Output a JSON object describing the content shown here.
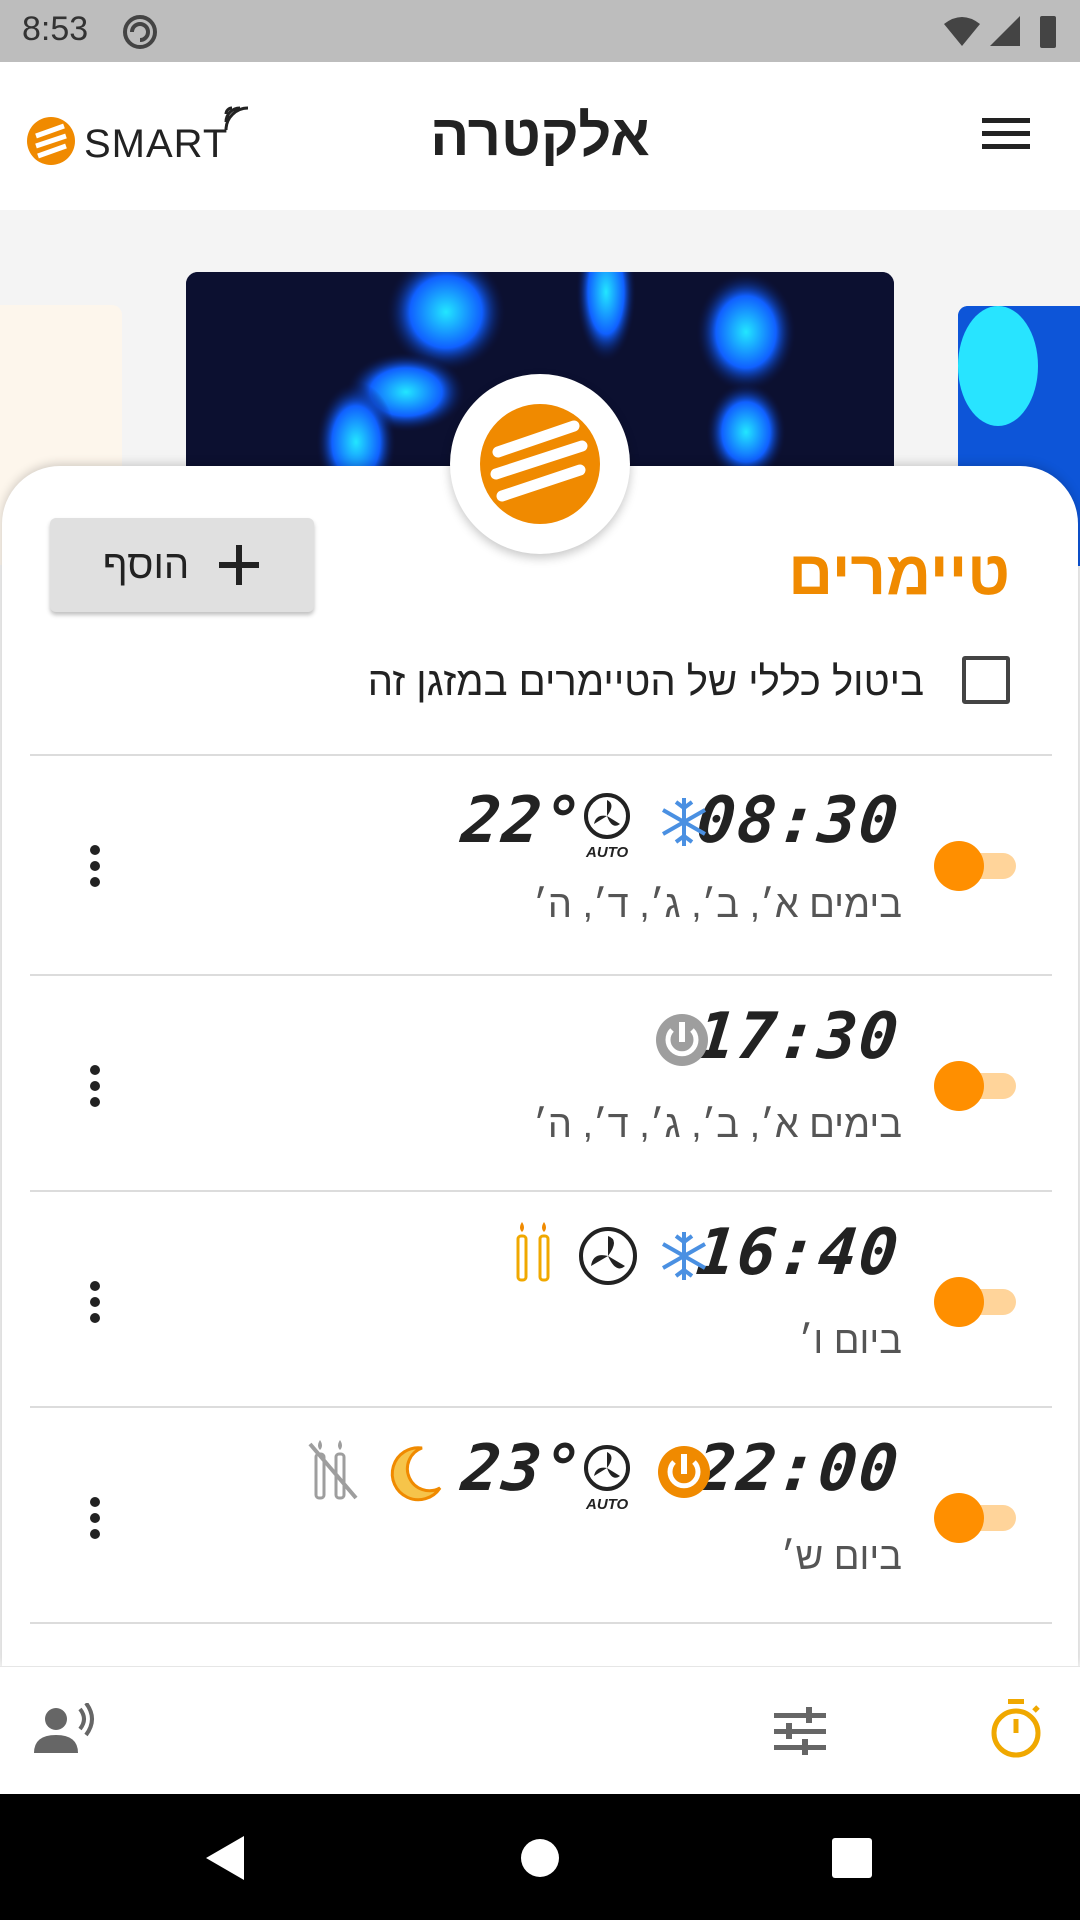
{
  "status": {
    "time": "8:53"
  },
  "app": {
    "smart_label": "SMART",
    "brand": "אלקטרה"
  },
  "timers": {
    "title": "טיימרים",
    "add_label": "הוסף",
    "cancel_all_label": "ביטול כללי של הטיימרים במזגן זה",
    "rows": [
      {
        "time": "08:30",
        "days": "בימים א׳, ב׳, ג׳, ד׳, ה׳",
        "temp": "22°",
        "fan_label": "AUTO",
        "mode": "cool",
        "enabled": true
      },
      {
        "time": "17:30",
        "days": "בימים א׳, ב׳, ג׳, ד׳, ה׳",
        "mode": "power-off",
        "enabled": true
      },
      {
        "time": "16:40",
        "days": "ביום ו׳",
        "mode": "cool",
        "enabled": true
      },
      {
        "time": "22:00",
        "days": "ביום ש׳",
        "temp": "23°",
        "fan_label": "AUTO",
        "mode": "power-on",
        "enabled": true
      }
    ]
  },
  "colors": {
    "accent": "#f08a00",
    "snow": "#4a90e2",
    "toggle": "#ff8f00"
  },
  "nav": {
    "items": [
      "voice-icon",
      "sliders-icon",
      "timer-icon"
    ],
    "active": "timer-icon"
  }
}
